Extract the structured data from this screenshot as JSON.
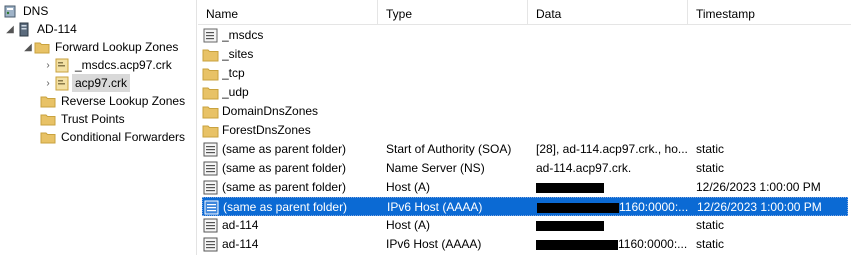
{
  "tree": {
    "root_label": "DNS",
    "server_label": "AD-114",
    "forward_label": "Forward Lookup Zones",
    "msdcs_zone_label": "_msdcs.acp97.crk",
    "zone_label": "acp97.crk",
    "reverse_label": "Reverse Lookup Zones",
    "trust_label": "Trust Points",
    "conditional_label": "Conditional Forwarders"
  },
  "columns": [
    "Name",
    "Type",
    "Data",
    "Timestamp"
  ],
  "rows": [
    {
      "name": "_msdcs",
      "type": "",
      "data": "",
      "timestamp": "",
      "icon": "folder-record"
    },
    {
      "name": "_sites",
      "type": "",
      "data": "",
      "timestamp": "",
      "icon": "folder"
    },
    {
      "name": "_tcp",
      "type": "",
      "data": "",
      "timestamp": "",
      "icon": "folder"
    },
    {
      "name": "_udp",
      "type": "",
      "data": "",
      "timestamp": "",
      "icon": "folder"
    },
    {
      "name": "DomainDnsZones",
      "type": "",
      "data": "",
      "timestamp": "",
      "icon": "folder"
    },
    {
      "name": "ForestDnsZones",
      "type": "",
      "data": "",
      "timestamp": "",
      "icon": "folder"
    },
    {
      "name": "(same as parent folder)",
      "type": "Start of Authority (SOA)",
      "data": "[28], ad-114.acp97.crk., ho...",
      "timestamp": "static",
      "icon": "record"
    },
    {
      "name": "(same as parent folder)",
      "type": "Name Server (NS)",
      "data": "ad-114.acp97.crk.",
      "timestamp": "static",
      "icon": "record"
    },
    {
      "name": "(same as parent folder)",
      "type": "Host (A)",
      "data": "",
      "timestamp": "12/26/2023 1:00:00 PM",
      "icon": "record",
      "redacted": true
    },
    {
      "name": "(same as parent folder)",
      "type": "IPv6 Host (AAAA)",
      "data": "1160:0000:...",
      "timestamp": "12/26/2023 1:00:00 PM",
      "icon": "record",
      "redacted": true,
      "selected": true
    },
    {
      "name": "ad-114",
      "type": "Host (A)",
      "data": "",
      "timestamp": "static",
      "icon": "record",
      "redacted": true
    },
    {
      "name": "ad-114",
      "type": "IPv6 Host (AAAA)",
      "data": "1160:0000:...",
      "timestamp": "static",
      "icon": "record",
      "redacted": true
    }
  ],
  "colors": {
    "selection": "#0b6ad4",
    "folder": "#e8c266",
    "folder_dark": "#c9a23e"
  }
}
